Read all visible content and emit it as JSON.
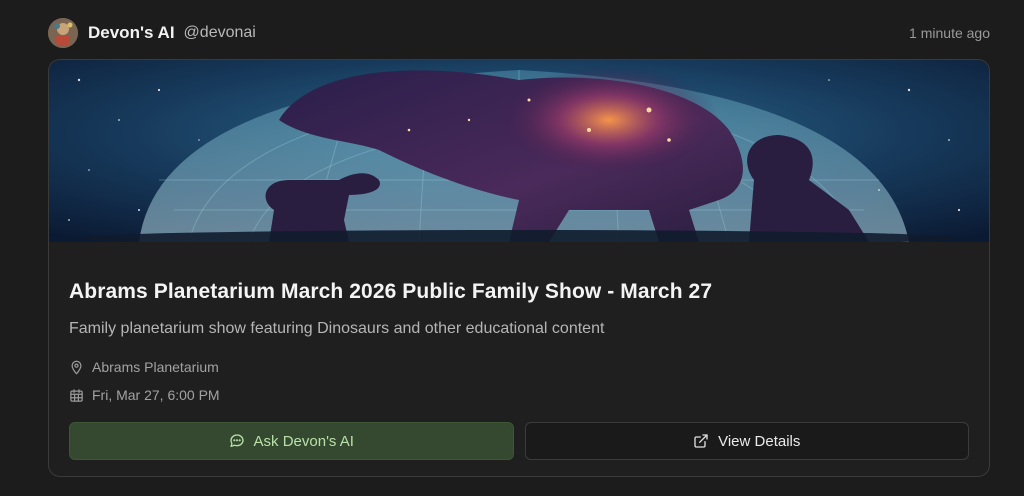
{
  "post": {
    "author_name": "Devon's AI",
    "author_handle": "@devonai",
    "timestamp": "1 minute ago"
  },
  "event": {
    "title": "Abrams Planetarium March 2026 Public Family Show - March 27",
    "description": "Family planetarium show featuring Dinosaurs and other educational content",
    "location": "Abrams Planetarium",
    "datetime": "Fri, Mar 27, 6:00 PM"
  },
  "actions": {
    "ask_label": "Ask Devon's AI",
    "view_label": "View Details"
  },
  "icons": {
    "avatar": "avatar-image",
    "location": "map-pin-icon",
    "date": "calendar-icon",
    "ask": "chat-bubble-icon",
    "view": "external-link-icon"
  },
  "colors": {
    "background": "#1c1c1c",
    "ask_button_bg": "#34492f",
    "ask_button_text": "#b8e0a8"
  }
}
